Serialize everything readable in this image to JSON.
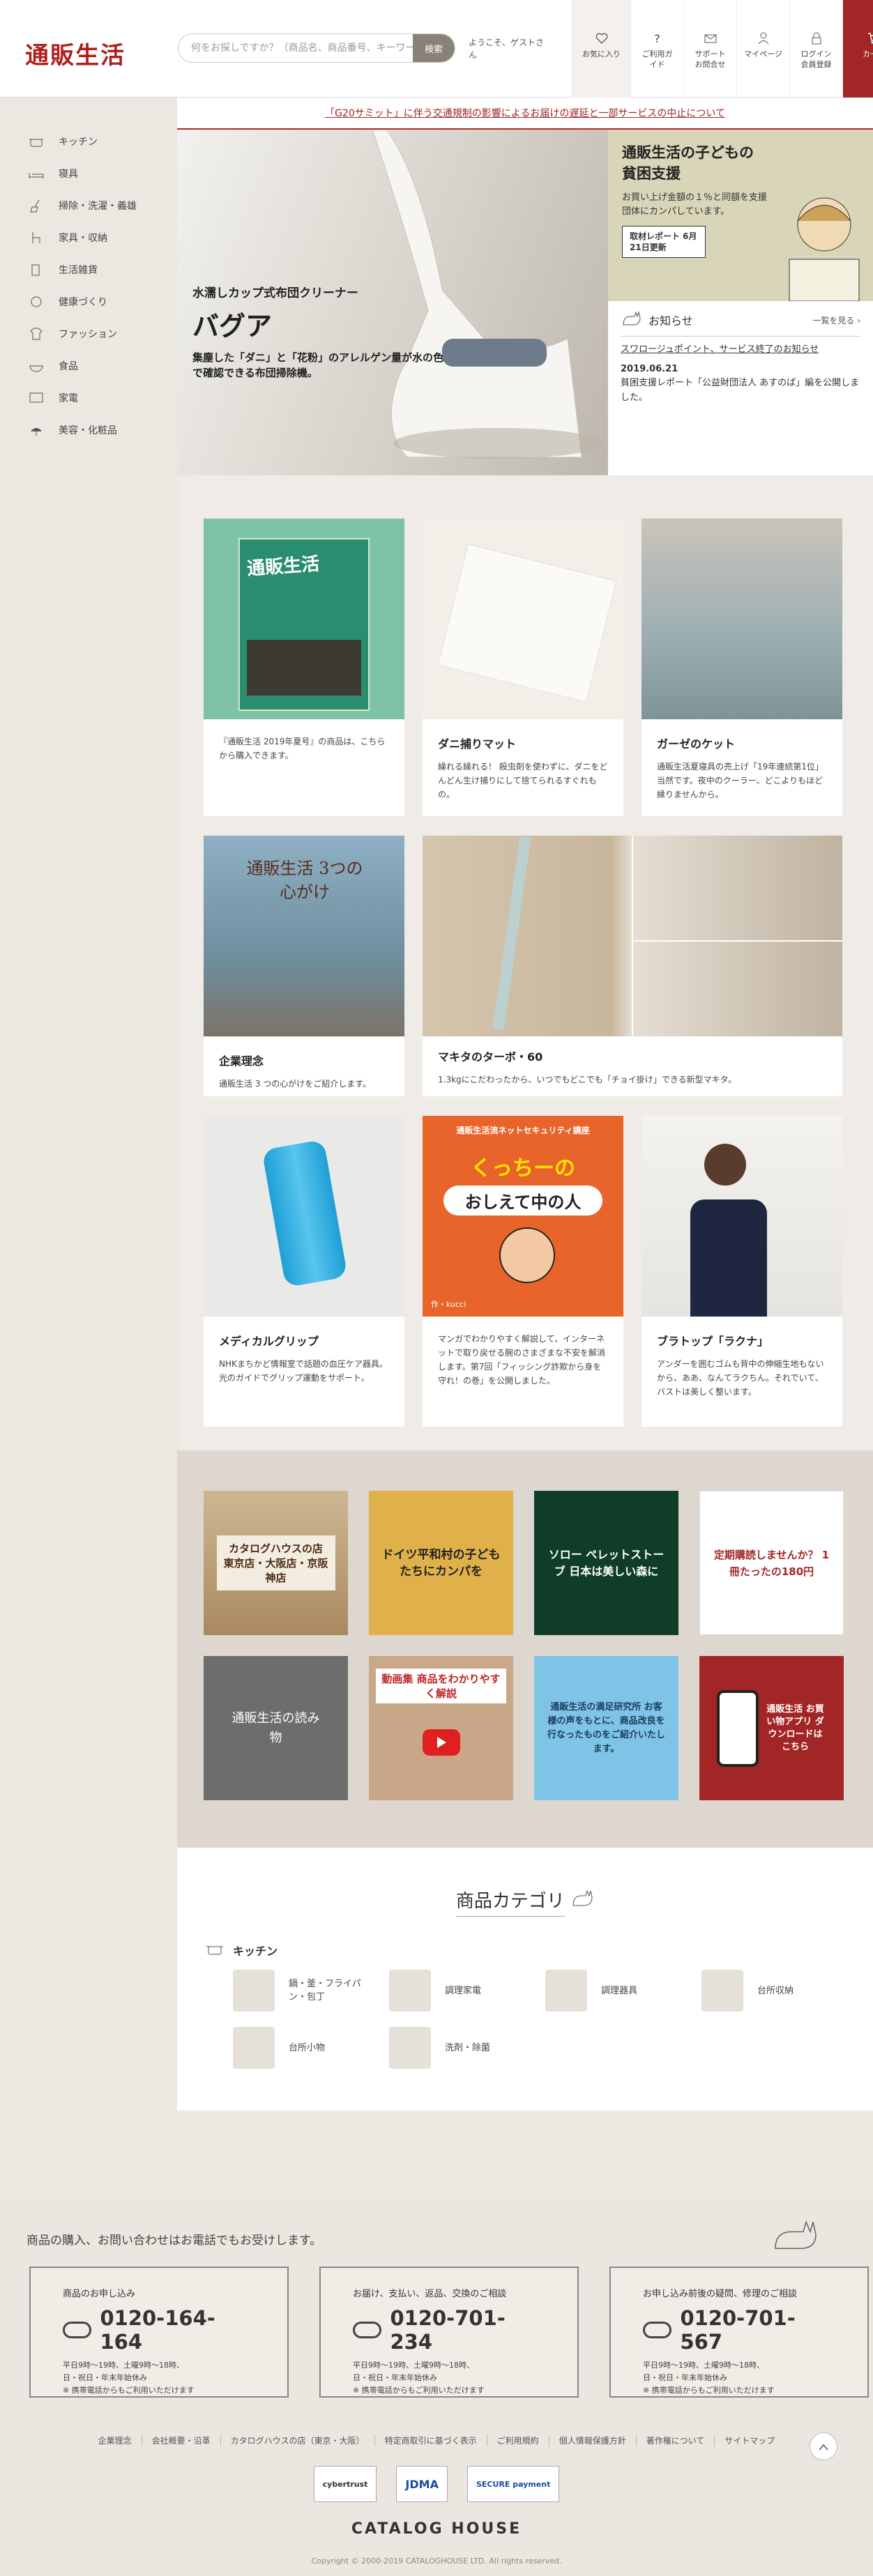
{
  "header": {
    "logo": "通販生活",
    "search_placeholder": "何をお探しですか？（商品名、商品番号、キーワード）",
    "search_button": "検索",
    "welcome": "ようこそ、ゲストさん",
    "nav": [
      {
        "label": "お気に入り",
        "icon": "heart-icon"
      },
      {
        "label": "ご利用ガイド",
        "icon": "question-icon"
      },
      {
        "label": "サポートお問合せ",
        "icon": "mail-icon"
      },
      {
        "label": "マイページ",
        "icon": "person-icon"
      },
      {
        "label": "ログイン会員登録",
        "icon": "lock-icon"
      },
      {
        "label": "カート",
        "icon": "cart-icon"
      }
    ]
  },
  "sidebar": {
    "items": [
      {
        "label": "キッチン",
        "icon": "pot-icon"
      },
      {
        "label": "寝具",
        "icon": "bed-icon"
      },
      {
        "label": "掃除・洗濯・義雄",
        "icon": "broom-icon"
      },
      {
        "label": "家具・収納",
        "icon": "chair-icon"
      },
      {
        "label": "生活雑貨",
        "icon": "cup-icon"
      },
      {
        "label": "健康づくり",
        "icon": "health-icon"
      },
      {
        "label": "ファッション",
        "icon": "shirt-icon"
      },
      {
        "label": "食品",
        "icon": "food-icon"
      },
      {
        "label": "家電",
        "icon": "appliance-icon"
      },
      {
        "label": "美容・化粧品",
        "icon": "cosmetics-icon"
      }
    ]
  },
  "notice": "「G20サミット」に伴う交通規制の影響によるお届けの遅延と一部サービスの中止について",
  "hero": {
    "sub": "水濡しカップ式布団クリーナー",
    "title": "バグア",
    "desc": "集塵した「ダニ」と「花粉」のアレルゲン量が水の色で確認できる布団掃除機。"
  },
  "promo": {
    "title": "通販生活の子どもの貧困支援",
    "desc": "お買い上げ金額の１％と同額を支援団体にカンパしています。",
    "link": "取材レポート 6月21日更新"
  },
  "news": {
    "title": "お知らせ",
    "more": "一覧を見る",
    "item1": "スワロージュポイント、サービス終了のお知らせ",
    "date2": "2019.06.21",
    "item2": "貧困支援レポート「公益財団法人 あすのば」編を公開しました。"
  },
  "cards": [
    {
      "title": "",
      "text": "『通販生活 2019年夏号』の商品は、こちらから購入できます。"
    },
    {
      "title": "ダニ捕りマット",
      "text": "繰れる繰れる！ 殺虫剤を使わずに、ダニをどんどん生け捕りにして捨てられるすぐれもの。"
    },
    {
      "title": "ガーゼのケット",
      "text": "通販生活夏寝具の売上げ「19年連続第1位」 当然です。夜中のクーラー、どこよりもほど縁りませんから。"
    },
    {
      "title": "企業理念",
      "text": "通販生活 3 つの心がけをご紹介します。"
    },
    {
      "title": "マキタのターボ・60",
      "text": "1.3kgにこだわったから、いつでもどこでも「チョイ掛け」できる新型マキタ。"
    },
    {
      "title": "メディカルグリップ",
      "text": "NHKまちかど情報室で話題の血圧ケア器具。光のガイドでグリップ運動をサポート。"
    },
    {
      "title": "",
      "text": "マンガでわかりやすく解説して、インターネットで取り戻せる腕のさまざまな不安を解消します。第7回「フィッシング詐欺から身を守れ！の巻」を公開しました。"
    },
    {
      "title": "ブラトップ「ラクナ」",
      "text": "アンダーを囲むゴムも背中の伸縮生地もないから、ああ、なんてラクちん。それでいて、バストは美しく整います。"
    }
  ],
  "card_images": {
    "c1": "通販生活",
    "c4": "通販生活 3つの心がけ",
    "c7a": "通販生活流ネットセキュリティ講座",
    "c7b": "くっちーの",
    "c7c": "おしえて中の人",
    "c7d": "作・kucci"
  },
  "banners": [
    {
      "text": "カタログハウスの店 東京店・大阪店・京阪神店"
    },
    {
      "text": "ドイツ平和村の子どもたちにカンパを"
    },
    {
      "text": "ソロー ペレットストーブ 日本は美しい森に"
    },
    {
      "text": "定期購読しませんか？ 1冊たったの180円"
    },
    {
      "text": "通販生活の読み物"
    },
    {
      "text": "動画集 商品をわかりやすく解説"
    },
    {
      "text": "通販生活の満足研究所 お客様の声をもとに、商品改良を行なったものをご紹介いたします。"
    },
    {
      "text": "通販生活 お買い物アプリ ダウンロードはこちら"
    }
  ],
  "categories": {
    "title": "商品カテゴリ",
    "heading": "キッチン",
    "items": [
      "鍋・釜・フライパン・包丁",
      "調理家電",
      "調理器具",
      "台所収納",
      "台所小物",
      "洗剤・除菌"
    ]
  },
  "footer": {
    "lead": "商品の購入、お問い合わせはお電話でもお受けします。",
    "boxes": [
      {
        "head": "商品のお申し込み",
        "num": "0120-164-164",
        "hours1": "平日9時〜19時、土曜9時〜18時、",
        "hours2": "日・祝日・年末年始休み",
        "hours3": "※ 携帯電話からもご利用いただけます"
      },
      {
        "head": "お届け、支払い、返品、交換のご相談",
        "num": "0120-701-234",
        "hours1": "平日9時〜19時、土曜9時〜18時、",
        "hours2": "日・祝日・年末年始休み",
        "hours3": "※ 携帯電話からもご利用いただけます"
      },
      {
        "head": "お申し込み前後の疑問、修理のご相談",
        "num": "0120-701-567",
        "hours1": "平日9時〜19時、土曜9時〜18時、",
        "hours2": "日・祝日・年末年始休み",
        "hours3": "※ 携帯電話からもご利用いただけます"
      }
    ],
    "links": [
      "企業理念",
      "会社概要・沿革",
      "カタログハウスの店（東京・大阪）",
      "特定商取引に基づく表示",
      "ご利用規約",
      "個人情報保護方針",
      "著作権について",
      "サイトマップ"
    ],
    "marks": [
      "cybertrust",
      "JDMA",
      "SECURE payment"
    ],
    "brand": "CATALOG HOUSE",
    "copyright": "Copyright © 2000-2019 CATALOGHOUSE LTD. All rights reserved."
  },
  "colors": {
    "brand": "#b01e1e",
    "cart": "#a32626",
    "bg": "#ece7e1"
  }
}
